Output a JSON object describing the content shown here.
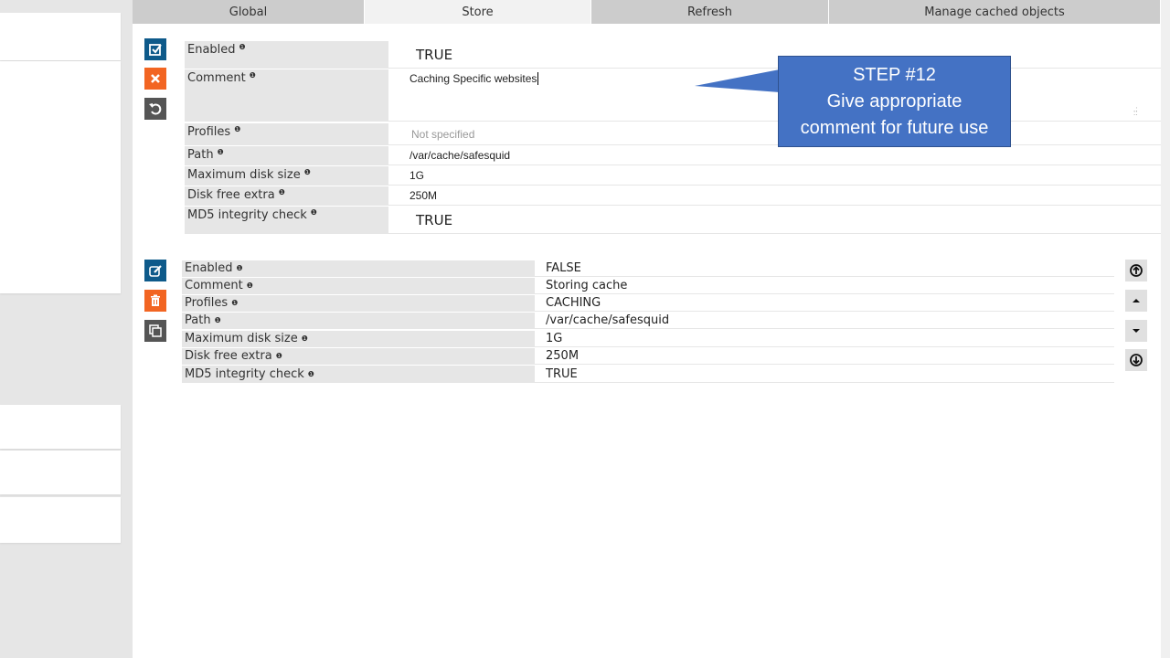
{
  "tabs": [
    {
      "label": "Global",
      "active": false
    },
    {
      "label": "Store",
      "active": true
    },
    {
      "label": "Refresh",
      "active": false
    },
    {
      "label": "Manage cached objects",
      "active": false
    }
  ],
  "edit_entry": {
    "actions": {
      "save": "check-icon",
      "cancel": "close-icon",
      "reset": "undo-icon"
    },
    "fields": [
      {
        "label": "Enabled",
        "value": "TRUE"
      },
      {
        "label": "Comment",
        "value": "Caching Specific websites"
      },
      {
        "label": "Profiles",
        "value": "",
        "placeholder": "Not specified"
      },
      {
        "label": "Path",
        "value": "/var/cache/safesquid"
      },
      {
        "label": "Maximum disk size",
        "value": "1G"
      },
      {
        "label": "Disk free extra",
        "value": "250M"
      },
      {
        "label": "MD5 integrity check",
        "value": "TRUE"
      }
    ]
  },
  "existing_entry": {
    "actions": {
      "edit": "edit-icon",
      "delete": "trash-icon",
      "duplicate": "copy-icon"
    },
    "fields": [
      {
        "label": "Enabled",
        "value": "FALSE"
      },
      {
        "label": "Comment",
        "value": "Storing cache"
      },
      {
        "label": "Profiles",
        "value": "CACHING"
      },
      {
        "label": "Path",
        "value": "/var/cache/safesquid"
      },
      {
        "label": "Maximum disk size",
        "value": "1G"
      },
      {
        "label": "Disk free extra",
        "value": "250M"
      },
      {
        "label": "MD5 integrity check",
        "value": "TRUE"
      }
    ],
    "move_buttons": [
      "move-to-top",
      "move-up",
      "move-down",
      "move-to-bottom"
    ]
  },
  "callout": {
    "line1": "STEP #12",
    "line2": "Give appropriate",
    "line3": "comment for future use",
    "color": "#4472c4"
  },
  "colors": {
    "save_blue": "#0e5a8a",
    "cancel_orange": "#f26522",
    "dark_gray": "#555555"
  }
}
